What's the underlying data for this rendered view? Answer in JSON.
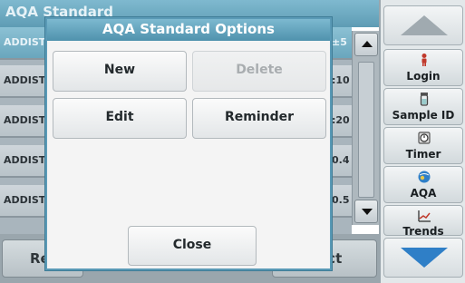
{
  "background": {
    "title": "AQA Standard",
    "rows": [
      {
        "left": "ADDIST",
        "right": "±5",
        "selected": true
      },
      {
        "left": "ADDIST",
        "right": ":10",
        "selected": false
      },
      {
        "left": "ADDIST",
        "right": ":20",
        "selected": false
      },
      {
        "left": "ADDIST",
        "right": "0.4",
        "selected": false
      },
      {
        "left": "ADDIST",
        "right": "0.5",
        "selected": false
      }
    ],
    "bottom_left_label": "Re",
    "bottom_right_label": "ect"
  },
  "sidebar": {
    "login_label": "Login",
    "sample_id_label": "Sample ID",
    "timer_label": "Timer",
    "aqa_label": "AQA",
    "trends_label": "Trends"
  },
  "dialog": {
    "title": "AQA Standard Options",
    "new_label": "New",
    "delete_label": "Delete",
    "edit_label": "Edit",
    "reminder_label": "Reminder",
    "close_label": "Close"
  },
  "colors": {
    "title_bar": "#5e9cb4",
    "dialog_header": "#4f92ad",
    "scroll_arrow_down": "#2f7fc7",
    "scroll_arrow_up": "#a0aab0"
  }
}
